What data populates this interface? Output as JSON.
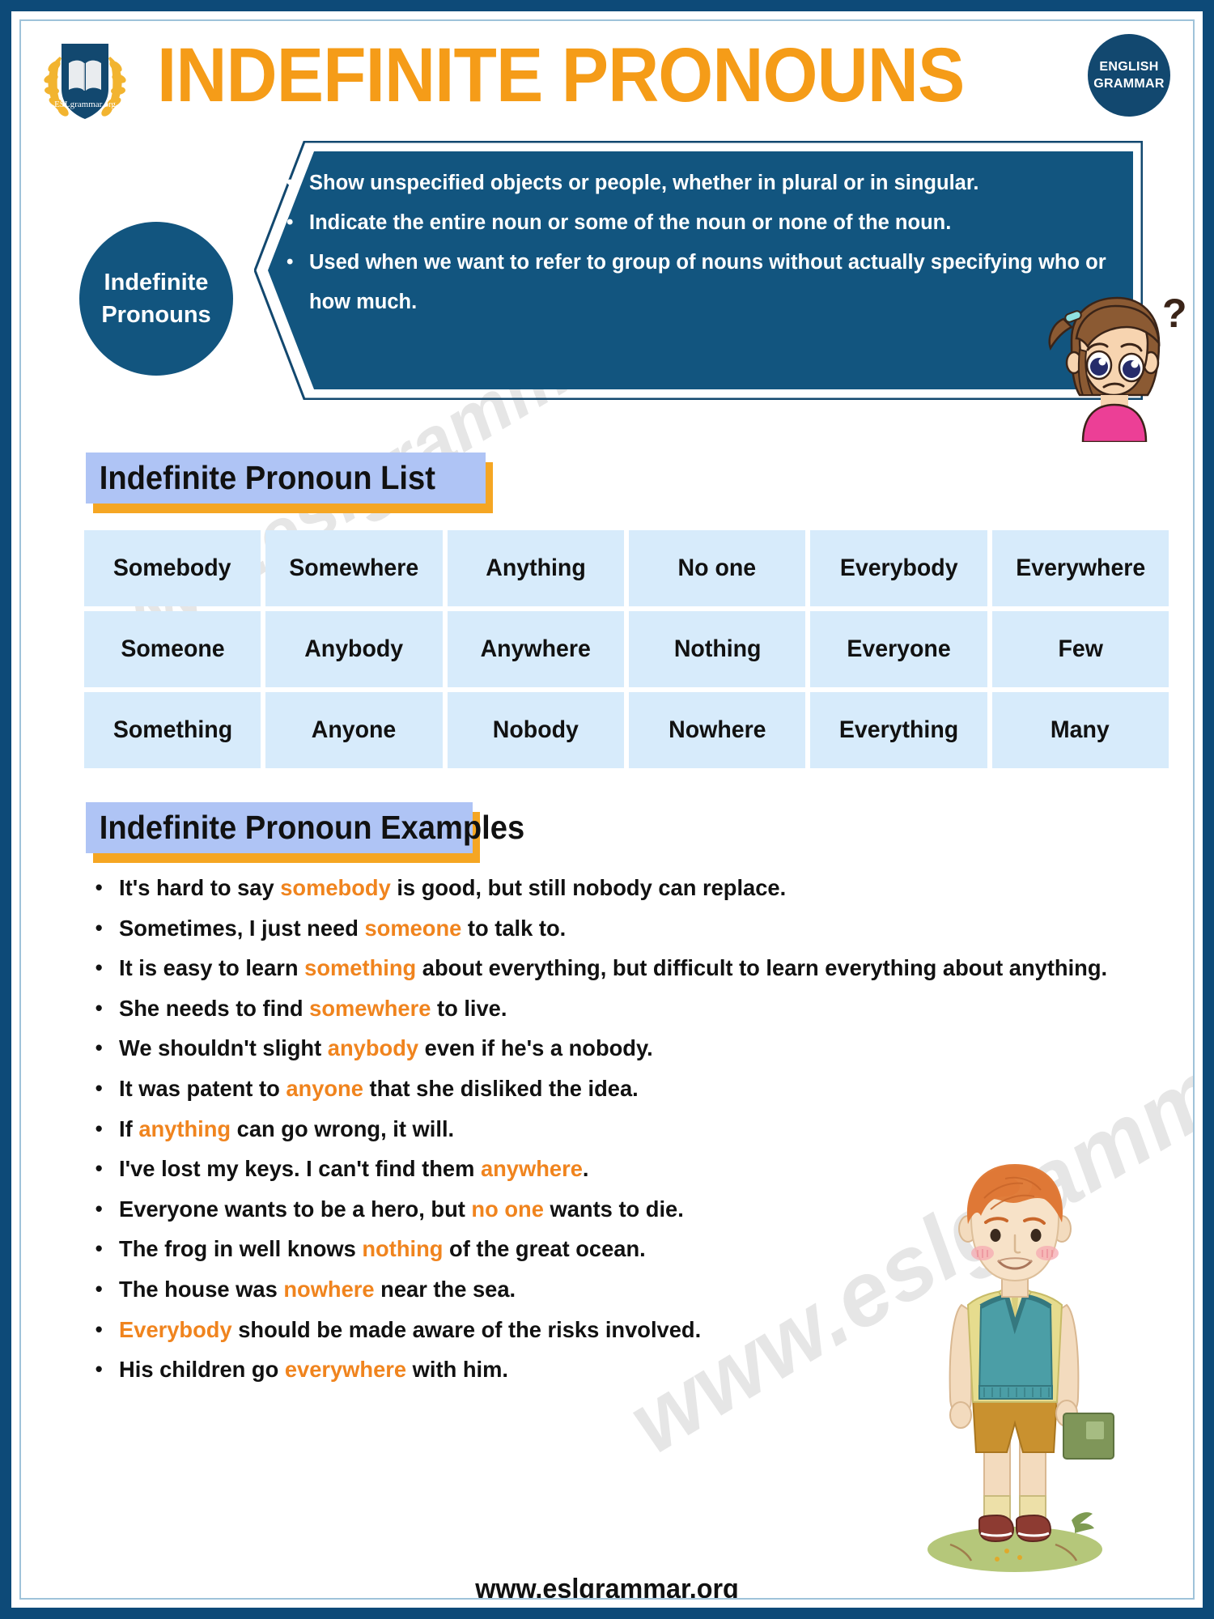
{
  "header": {
    "title": "INDEFINITE PRONOUNS",
    "logo_text": "ESLgrammar.org",
    "badge_line1": "ENGLISH",
    "badge_line2": "GRAMMAR"
  },
  "intro": {
    "circle_line1": "Indefinite",
    "circle_line2": "Pronouns",
    "bullets": [
      "Show unspecified objects or people, whether in plural or in singular.",
      "Indicate the entire noun or some of the noun or none of the noun.",
      "Used when we want to refer to group of nouns without actually specifying who or how much."
    ]
  },
  "list_section": {
    "banner_label": "Indefinite Pronoun List",
    "rows": [
      [
        "Somebody",
        "Somewhere",
        "Anything",
        "No one",
        "Everybody",
        "Everywhere"
      ],
      [
        "Someone",
        "Anybody",
        "Anywhere",
        "Nothing",
        "Everyone",
        "Few"
      ],
      [
        "Something",
        "Anyone",
        "Nobody",
        "Nowhere",
        "Everything",
        "Many"
      ]
    ]
  },
  "examples_section": {
    "banner_label": "Indefinite Pronoun Examples",
    "items": [
      [
        {
          "t": "It's hard to say ",
          "h": false
        },
        {
          "t": "somebody",
          "h": true
        },
        {
          "t": " is good, but still nobody can replace.",
          "h": false
        }
      ],
      [
        {
          "t": "Sometimes, I just need ",
          "h": false
        },
        {
          "t": "someone",
          "h": true
        },
        {
          "t": " to talk to.",
          "h": false
        }
      ],
      [
        {
          "t": "It is easy to learn ",
          "h": false
        },
        {
          "t": "something",
          "h": true
        },
        {
          "t": " about everything, but difficult to learn everything about anything.",
          "h": false
        }
      ],
      [
        {
          "t": "She needs to find ",
          "h": false
        },
        {
          "t": "somewhere",
          "h": true
        },
        {
          "t": " to live.",
          "h": false
        }
      ],
      [
        {
          "t": "We shouldn't slight ",
          "h": false
        },
        {
          "t": "anybody",
          "h": true
        },
        {
          "t": " even if he's a nobody.",
          "h": false
        }
      ],
      [
        {
          "t": "It was patent to ",
          "h": false
        },
        {
          "t": "anyone",
          "h": true
        },
        {
          "t": " that she disliked the idea.",
          "h": false
        }
      ],
      [
        {
          "t": "If ",
          "h": false
        },
        {
          "t": "anything",
          "h": true
        },
        {
          "t": " can go wrong, it will.",
          "h": false
        }
      ],
      [
        {
          "t": "I've lost my keys. I can't find them ",
          "h": false
        },
        {
          "t": "anywhere",
          "h": true
        },
        {
          "t": ".",
          "h": false
        }
      ],
      [
        {
          "t": "Everyone wants to be a hero, but ",
          "h": false
        },
        {
          "t": "no one",
          "h": true
        },
        {
          "t": " wants to die.",
          "h": false
        }
      ],
      [
        {
          "t": "The frog in well knows ",
          "h": false
        },
        {
          "t": "nothing",
          "h": true
        },
        {
          "t": " of the great ocean.",
          "h": false
        }
      ],
      [
        {
          "t": "The house was ",
          "h": false
        },
        {
          "t": "nowhere",
          "h": true
        },
        {
          "t": " near the sea.",
          "h": false
        }
      ],
      [
        {
          "t": "Everybody",
          "h": true
        },
        {
          "t": " should be made aware of the risks involved.",
          "h": false
        }
      ],
      [
        {
          "t": "His children go ",
          "h": false
        },
        {
          "t": "everywhere",
          "h": true
        },
        {
          "t": " with him.",
          "h": false
        }
      ]
    ]
  },
  "footer": {
    "url": "www.eslgrammar.org"
  },
  "watermark": {
    "text": "www.eslgrammar.org"
  },
  "colors": {
    "frame_blue": "#0d4a78",
    "accent_orange": "#F59C18",
    "highlight_orange": "#F0841E",
    "callout_blue": "#12557f",
    "banner_blue": "#AFC4F5",
    "banner_shadow": "#F5A623",
    "cell_blue": "#D7EBFB"
  },
  "icons": {
    "logo": "book-laurel-logo-icon",
    "girl": "confused-girl-icon",
    "boy": "schoolboy-with-book-icon",
    "question_mark": "question-mark-icon"
  }
}
